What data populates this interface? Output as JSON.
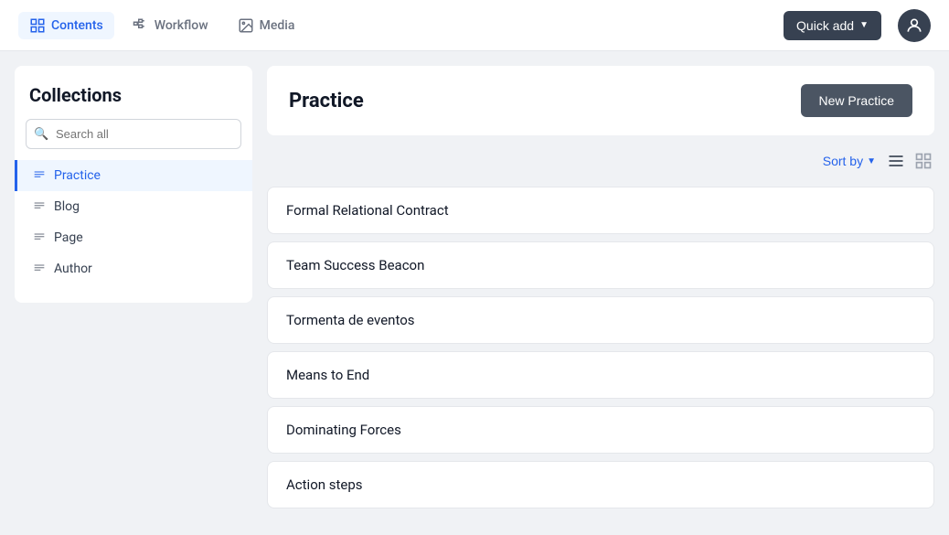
{
  "nav": {
    "tabs": [
      {
        "id": "contents",
        "label": "Contents",
        "active": true
      },
      {
        "id": "workflow",
        "label": "Workflow",
        "active": false
      },
      {
        "id": "media",
        "label": "Media",
        "active": false
      }
    ],
    "quick_add_label": "Quick add",
    "user_icon": "user-avatar"
  },
  "sidebar": {
    "title": "Collections",
    "search_placeholder": "Search all",
    "items": [
      {
        "id": "practice",
        "label": "Practice",
        "active": true
      },
      {
        "id": "blog",
        "label": "Blog",
        "active": false
      },
      {
        "id": "page",
        "label": "Page",
        "active": false
      },
      {
        "id": "author",
        "label": "Author",
        "active": false
      }
    ]
  },
  "content": {
    "title": "Practice",
    "new_button_label": "New Practice",
    "sort_by_label": "Sort by",
    "items": [
      {
        "id": 1,
        "name": "Formal Relational Contract"
      },
      {
        "id": 2,
        "name": "Team Success Beacon"
      },
      {
        "id": 3,
        "name": "Tormenta de eventos"
      },
      {
        "id": 4,
        "name": "Means to End"
      },
      {
        "id": 5,
        "name": "Dominating Forces"
      },
      {
        "id": 6,
        "name": "Action steps"
      }
    ]
  }
}
